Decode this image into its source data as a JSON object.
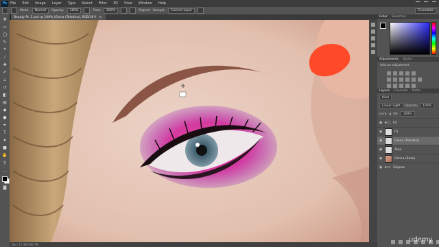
{
  "app": {
    "logo": "Ps"
  },
  "menu": [
    "File",
    "Edit",
    "Image",
    "Layer",
    "Type",
    "Select",
    "Filter",
    "3D",
    "View",
    "Window",
    "Help"
  ],
  "options": {
    "mode_label": "Mode:",
    "mode_value": "Normal",
    "opacity_label": "Opacity:",
    "opacity_value": "100%",
    "flow_label": "Flow:",
    "flow_value": "100%",
    "aligned_label": "Aligned",
    "sample_label": "Sample:",
    "sample_value": "Current Layer",
    "workspace": "Essentials"
  },
  "document": {
    "tab_title": "Beauty Pt. 2.psd @ 100% (Glena (Teledica), RGB/16*)",
    "status_text": "Doc: 17.4M/106.7M"
  },
  "panels": {
    "color_tabs": [
      "Color",
      "Swatches"
    ],
    "adjust_tabs": [
      "Adjustments",
      "Styles"
    ],
    "adjust_add": "Add an adjustment",
    "layers_tabs": [
      "Layers",
      "Channels",
      "Paths"
    ],
    "kind_label": "Kind",
    "blend_mode": "Linear Light",
    "opacity_label": "Opacity:",
    "opacity_value": "100%",
    "lock_label": "Lock:",
    "fill_label": "Fill:",
    "fill_value": "100%"
  },
  "layers": [
    {
      "name": "FS",
      "type": "folder",
      "selected": false
    },
    {
      "name": "FS",
      "type": "layer",
      "selected": false
    },
    {
      "name": "Glena (Teledica)",
      "type": "layer",
      "selected": true
    },
    {
      "name": "Tone",
      "type": "layer",
      "selected": false
    },
    {
      "name": "Dalina (Bake)",
      "type": "face",
      "selected": false
    },
    {
      "name": "Zdgene",
      "type": "folder",
      "selected": false
    }
  ],
  "watermark": "udemy",
  "colors": {
    "menubar": "#3c3c3c",
    "panel": "#535353",
    "skin": "#e5c3b3",
    "eyeshadow": "#e0339a",
    "nail": "#ff4a2a"
  }
}
